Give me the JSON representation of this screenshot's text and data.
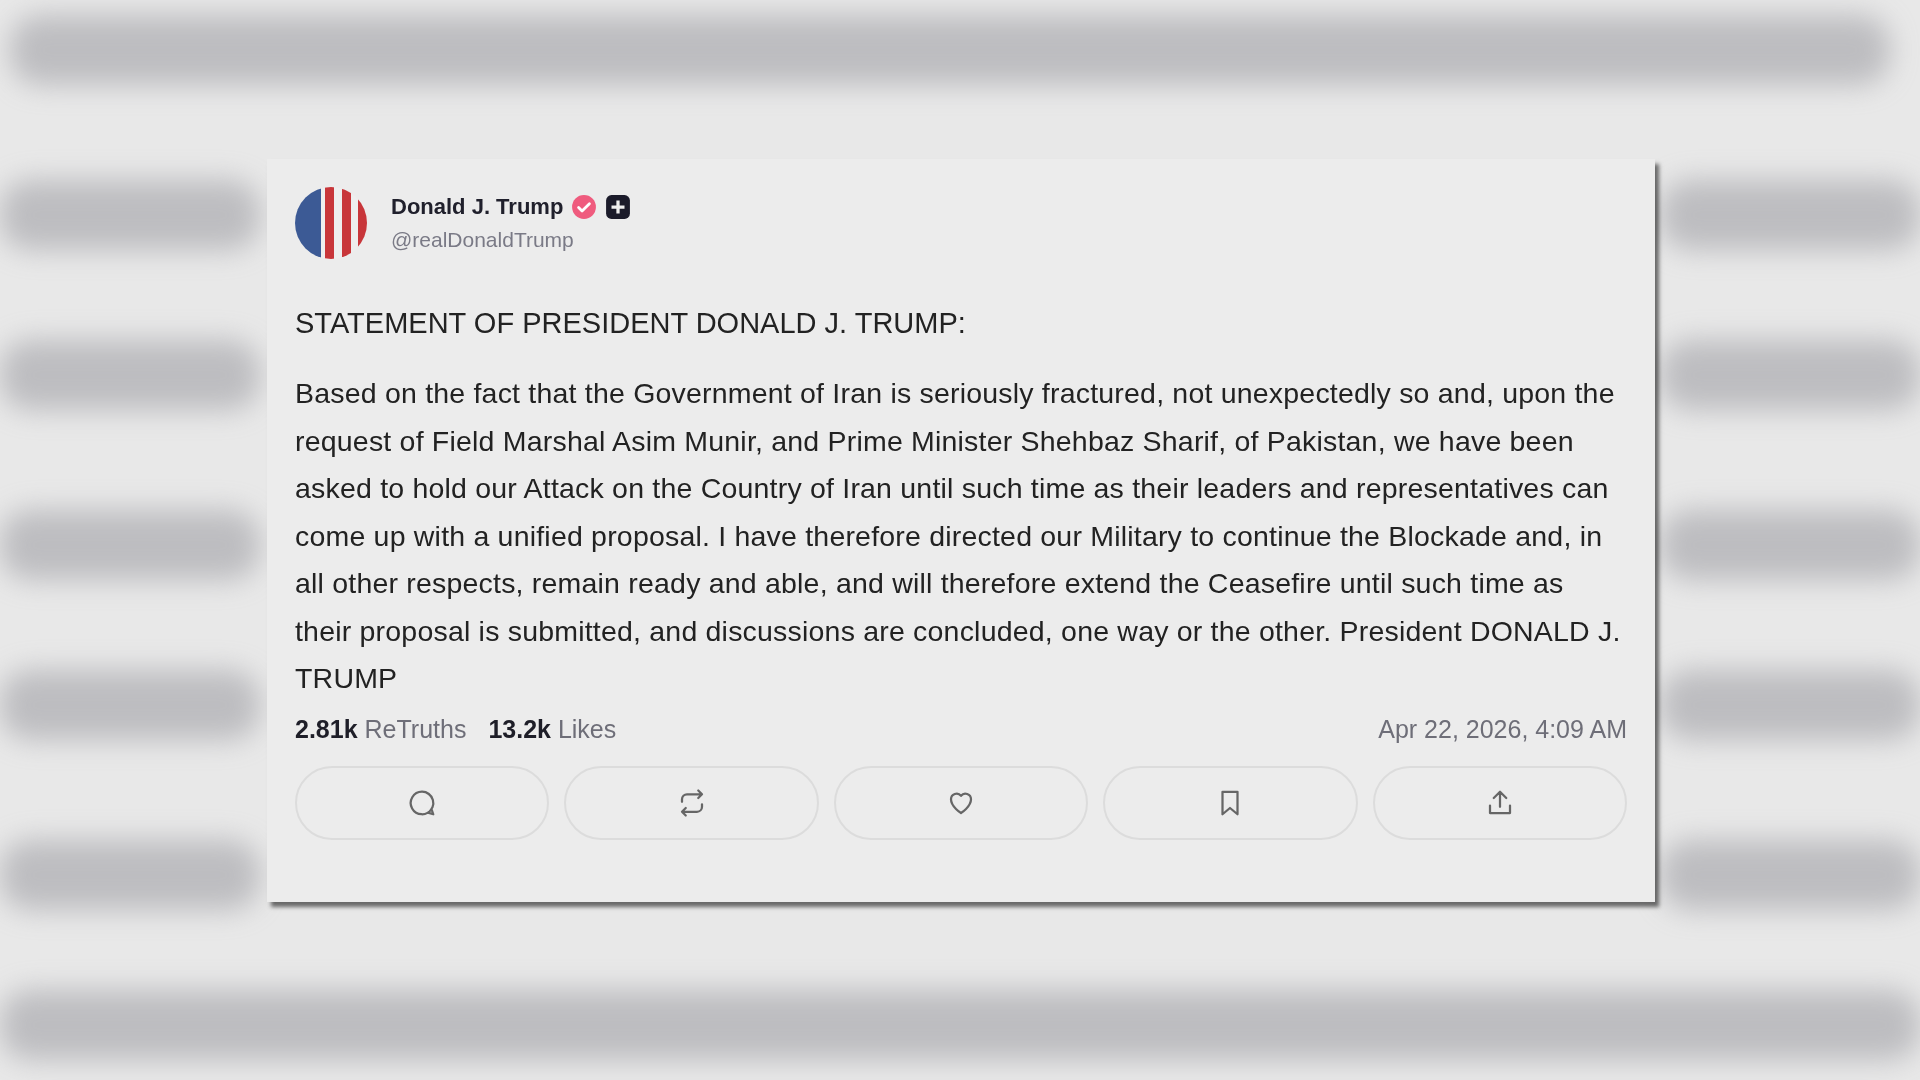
{
  "post": {
    "author": {
      "name": "Donald J. Trump",
      "handle": "@realDonaldTrump",
      "verified": true
    },
    "title": "STATEMENT OF PRESIDENT DONALD J. TRUMP:",
    "body": "Based on the fact that the Government of Iran is seriously fractured, not unexpectedly so and, upon the request of Field Marshal Asim Munir, and Prime Minister Shehbaz Sharif, of Pakistan, we have been asked to hold our Attack on the Country of Iran until such time as their leaders and representatives can come up with a unified proposal. I have therefore directed our Military to continue the Blockade and, in all other respects, remain ready and able, and will therefore extend the Ceasefire until such time as their proposal is submitted, and discussions are concluded, one way or the other. President DONALD J. TRUMP",
    "stats": [
      {
        "count": "2.81k",
        "label": "ReTruths"
      },
      {
        "count": "13.2k",
        "label": "Likes"
      }
    ],
    "timestamp": "Apr 22, 2026, 4:09 AM",
    "actions": [
      {
        "kind": "reply"
      },
      {
        "kind": "repost"
      },
      {
        "kind": "like"
      },
      {
        "kind": "bookmark"
      },
      {
        "kind": "share"
      }
    ]
  }
}
